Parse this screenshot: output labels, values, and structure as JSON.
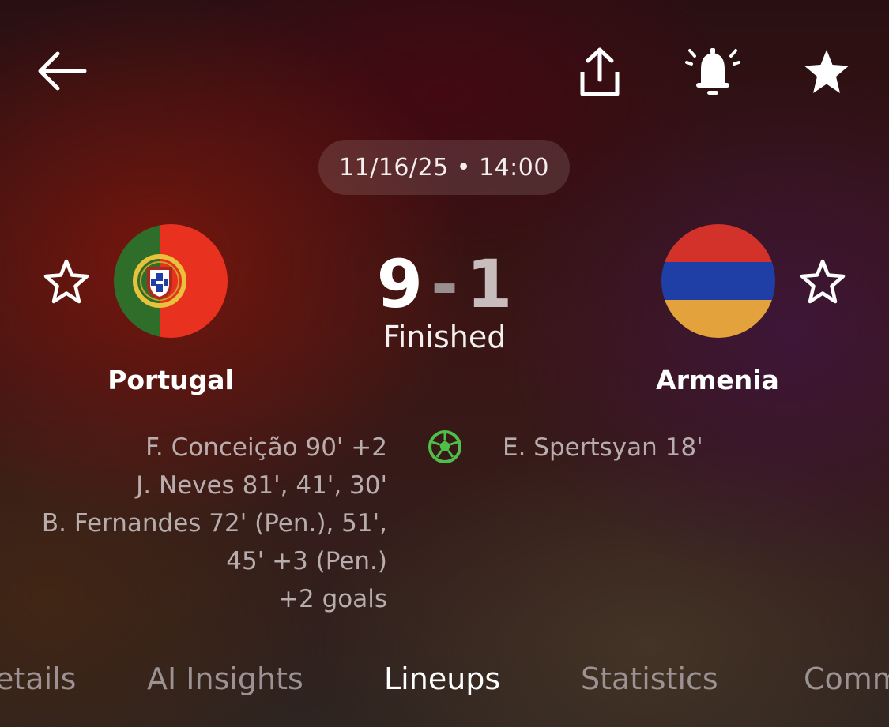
{
  "header": {
    "back_icon": "arrow-left-icon",
    "share_icon": "share-icon",
    "notify_icon": "bell-ringing-icon",
    "favorite_icon": "star-filled-icon"
  },
  "match": {
    "date": "11/16/25",
    "separator": "•",
    "time": "14:00",
    "home_score": "9",
    "score_dash": "-",
    "away_score": "1",
    "status": "Finished"
  },
  "home_team": {
    "name": "Portugal",
    "favorite_icon": "star-outline-icon",
    "flag_colors": {
      "green": "#2f6e2a",
      "red": "#e8321f",
      "emblem": "#e8c23a"
    },
    "scorers": [
      "F. Conceição 90' +2",
      "J. Neves 81', 41', 30'",
      "B. Fernandes 72' (Pen.), 51',",
      "45' +3 (Pen.)",
      "+2 goals"
    ]
  },
  "away_team": {
    "name": "Armenia",
    "favorite_icon": "star-outline-icon",
    "flag_colors": {
      "red": "#d2322a",
      "blue": "#1f3ea6",
      "orange": "#e3a23b"
    },
    "scorers": [
      "E. Spertsyan 18'"
    ]
  },
  "goal_icon": {
    "name": "soccer-ball-icon",
    "color": "#4fbf4a"
  },
  "tabs": [
    {
      "label": "etails",
      "active": false
    },
    {
      "label": "AI Insights",
      "active": false
    },
    {
      "label": "Lineups",
      "active": true
    },
    {
      "label": "Statistics",
      "active": false
    },
    {
      "label": "Comm",
      "active": false
    }
  ]
}
